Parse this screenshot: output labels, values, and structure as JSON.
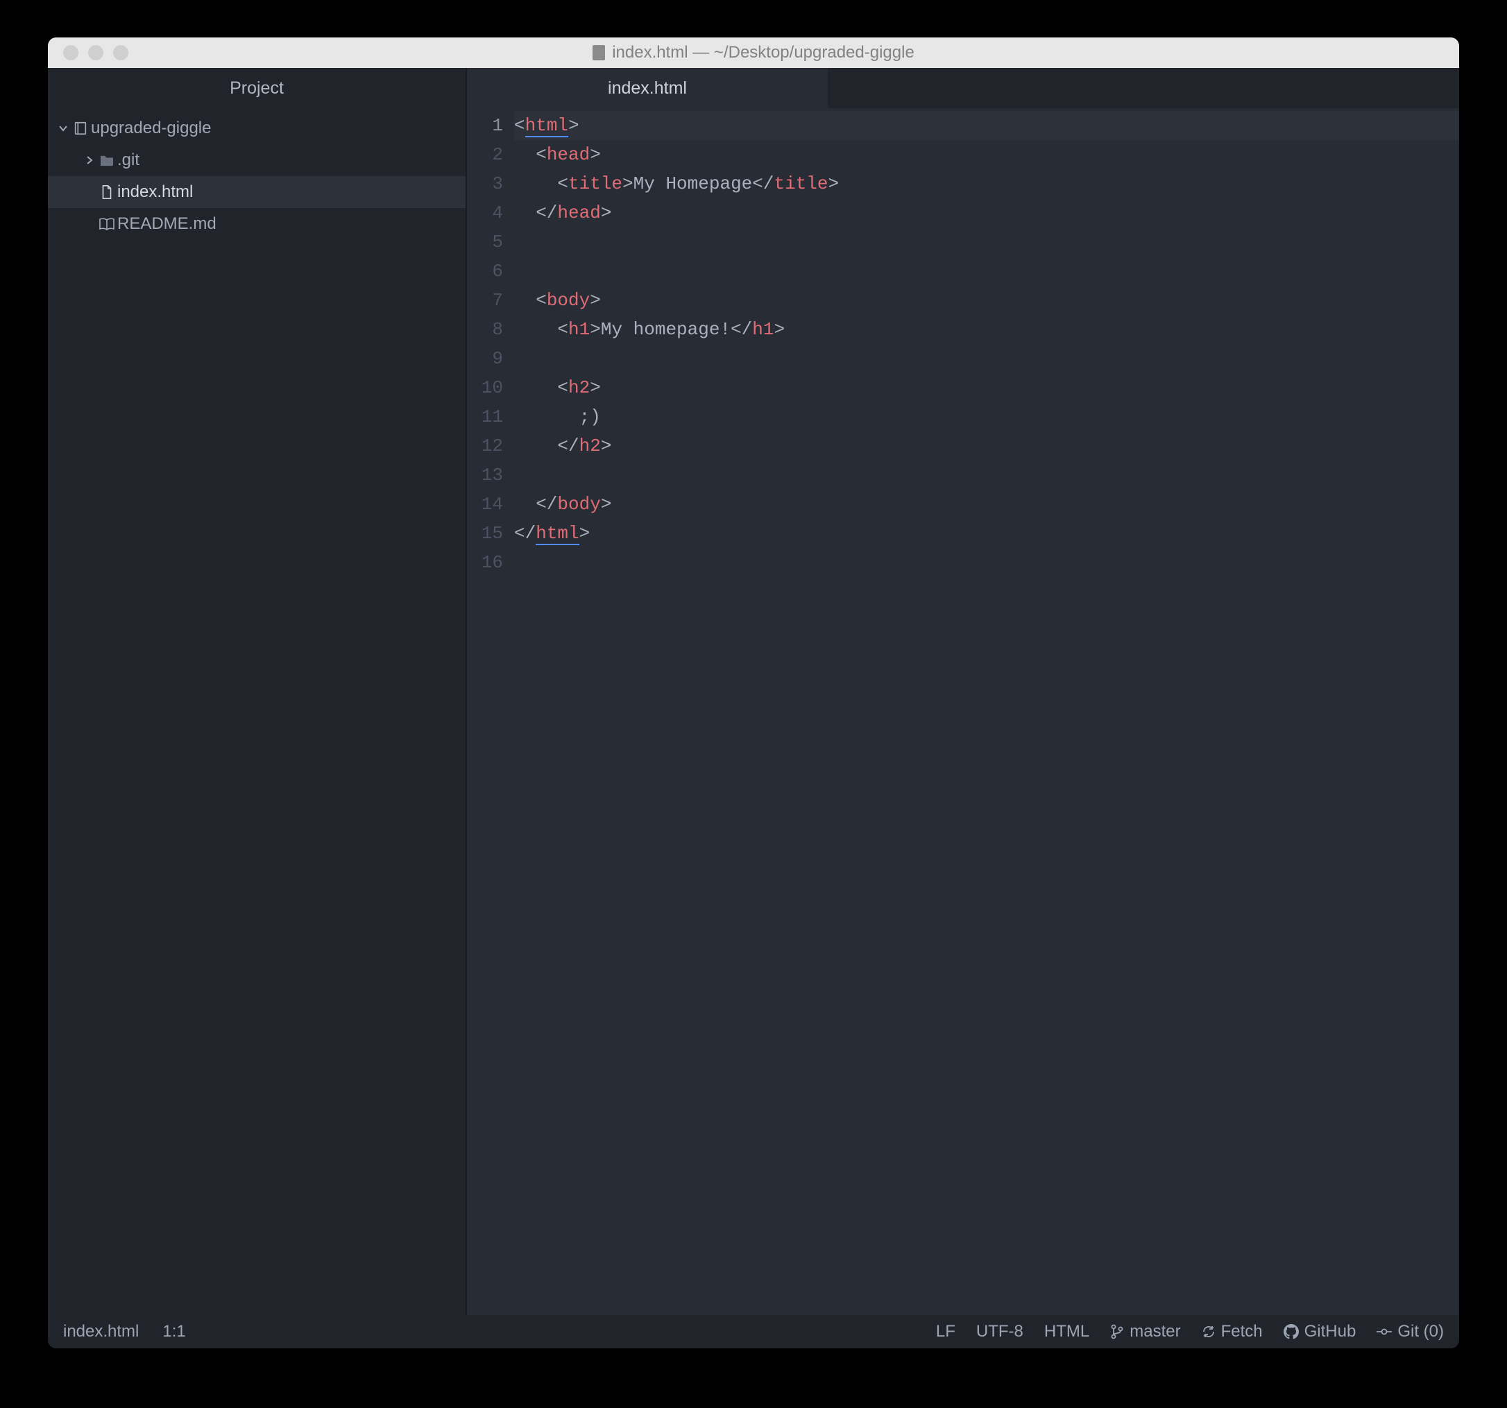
{
  "titlebar": {
    "title": "index.html — ~/Desktop/upgraded-giggle"
  },
  "sidebar": {
    "tab_label": "Project",
    "tree": {
      "root": {
        "name": "upgraded-giggle"
      },
      "items": [
        {
          "name": ".git",
          "kind": "folder"
        },
        {
          "name": "index.html",
          "kind": "file",
          "selected": true
        },
        {
          "name": "README.md",
          "kind": "book"
        }
      ]
    }
  },
  "editor": {
    "tab_label": "index.html",
    "line_numbers": [
      "1",
      "2",
      "3",
      "4",
      "5",
      "6",
      "7",
      "8",
      "9",
      "10",
      "11",
      "12",
      "13",
      "14",
      "15",
      "16"
    ],
    "current_line": 1,
    "code": [
      [
        {
          "t": "<",
          "c": "punc"
        },
        {
          "t": "html",
          "c": "tag underline"
        },
        {
          "t": ">",
          "c": "punc"
        }
      ],
      [
        {
          "t": "  <",
          "c": "punc"
        },
        {
          "t": "head",
          "c": "tag"
        },
        {
          "t": ">",
          "c": "punc"
        }
      ],
      [
        {
          "t": "    <",
          "c": "punc"
        },
        {
          "t": "title",
          "c": "tag"
        },
        {
          "t": ">",
          "c": "punc"
        },
        {
          "t": "My Homepage",
          "c": "text"
        },
        {
          "t": "</",
          "c": "punc"
        },
        {
          "t": "title",
          "c": "tag"
        },
        {
          "t": ">",
          "c": "punc"
        }
      ],
      [
        {
          "t": "  </",
          "c": "punc"
        },
        {
          "t": "head",
          "c": "tag"
        },
        {
          "t": ">",
          "c": "punc"
        }
      ],
      [],
      [],
      [
        {
          "t": "  <",
          "c": "punc"
        },
        {
          "t": "body",
          "c": "tag"
        },
        {
          "t": ">",
          "c": "punc"
        }
      ],
      [
        {
          "t": "    <",
          "c": "punc"
        },
        {
          "t": "h1",
          "c": "tag"
        },
        {
          "t": ">",
          "c": "punc"
        },
        {
          "t": "My homepage!",
          "c": "text"
        },
        {
          "t": "</",
          "c": "punc"
        },
        {
          "t": "h1",
          "c": "tag"
        },
        {
          "t": ">",
          "c": "punc"
        }
      ],
      [],
      [
        {
          "t": "    <",
          "c": "punc"
        },
        {
          "t": "h2",
          "c": "tag"
        },
        {
          "t": ">",
          "c": "punc"
        }
      ],
      [
        {
          "t": "      ;)",
          "c": "text"
        }
      ],
      [
        {
          "t": "    </",
          "c": "punc"
        },
        {
          "t": "h2",
          "c": "tag"
        },
        {
          "t": ">",
          "c": "punc"
        }
      ],
      [],
      [
        {
          "t": "  </",
          "c": "punc"
        },
        {
          "t": "body",
          "c": "tag"
        },
        {
          "t": ">",
          "c": "punc"
        }
      ],
      [
        {
          "t": "</",
          "c": "punc"
        },
        {
          "t": "html",
          "c": "tag underline"
        },
        {
          "t": ">",
          "c": "punc"
        }
      ],
      []
    ]
  },
  "statusbar": {
    "file": "index.html",
    "cursor": "1:1",
    "line_ending": "LF",
    "encoding": "UTF-8",
    "language": "HTML",
    "branch": "master",
    "fetch": "Fetch",
    "github": "GitHub",
    "git": "Git (0)"
  }
}
